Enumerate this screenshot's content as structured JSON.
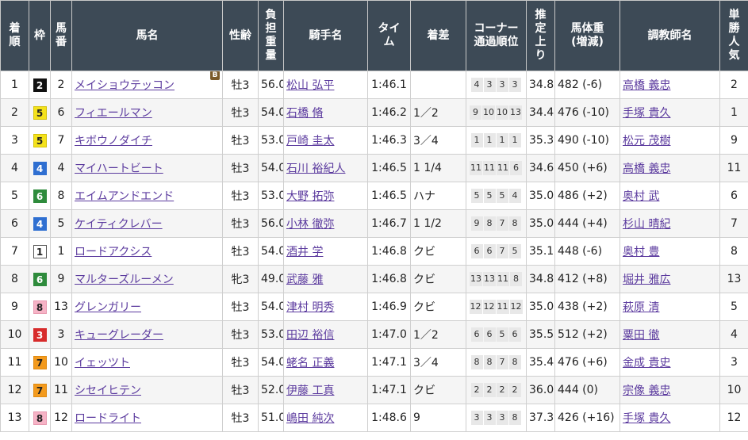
{
  "headers": {
    "rank": [
      "着",
      "順"
    ],
    "waku": [
      "枠"
    ],
    "umaban": [
      "馬",
      "番"
    ],
    "name": [
      "馬名"
    ],
    "sexage": [
      "性齢"
    ],
    "weight": [
      "負",
      "担",
      "重",
      "量"
    ],
    "jockey": [
      "騎手名"
    ],
    "time": [
      "タイ",
      "ム"
    ],
    "margin": [
      "着差"
    ],
    "corner": [
      "コーナー",
      "通過順位"
    ],
    "agari": [
      "推",
      "定",
      "上",
      "り"
    ],
    "body": [
      "馬体重",
      "(増減)"
    ],
    "trainer": [
      "調教師名"
    ],
    "pop": [
      "単",
      "勝",
      "人",
      "気"
    ]
  },
  "waku_colors": {
    "1": {
      "bg": "#ffffff",
      "fg": "#222222",
      "border": "#555555"
    },
    "2": {
      "bg": "#111111",
      "fg": "#ffffff",
      "border": "#111111"
    },
    "3": {
      "bg": "#d72b2b",
      "fg": "#ffffff",
      "border": "#d72b2b"
    },
    "4": {
      "bg": "#2f6fd1",
      "fg": "#ffffff",
      "border": "#2f6fd1"
    },
    "5": {
      "bg": "#f4e21b",
      "fg": "#222222",
      "border": "#d4c20b"
    },
    "6": {
      "bg": "#2e8b3c",
      "fg": "#ffffff",
      "border": "#2e8b3c"
    },
    "7": {
      "bg": "#f39a1d",
      "fg": "#222222",
      "border": "#e08a10"
    },
    "8": {
      "bg": "#f6b3c6",
      "fg": "#222222",
      "border": "#e89ab0"
    }
  },
  "rows": [
    {
      "rank": "1",
      "waku": "2",
      "umaban": "2",
      "name": "メイショウテッコン",
      "blinker": "B",
      "sexage": "牡3",
      "weight": "56.0",
      "jockey": "松山 弘平",
      "time": "1:46.1",
      "margin": "",
      "corner": [
        "4",
        "3",
        "3",
        "3"
      ],
      "agari": "34.8",
      "body": "482 (-6)",
      "trainer": "高橋 義忠",
      "pop": "2"
    },
    {
      "rank": "2",
      "waku": "5",
      "umaban": "6",
      "name": "フィエールマン",
      "blinker": "",
      "sexage": "牡3",
      "weight": "54.0",
      "jockey": "石橋 脩",
      "time": "1:46.2",
      "margin": "1／2",
      "corner": [
        "9",
        "10",
        "10",
        "13"
      ],
      "agari": "34.4",
      "body": "476 (-10)",
      "trainer": "手塚 貴久",
      "pop": "1"
    },
    {
      "rank": "3",
      "waku": "5",
      "umaban": "7",
      "name": "キボウノダイチ",
      "blinker": "",
      "sexage": "牡3",
      "weight": "53.0",
      "jockey": "戸崎 圭太",
      "time": "1:46.3",
      "margin": "3／4",
      "corner": [
        "1",
        "1",
        "1",
        "1"
      ],
      "agari": "35.3",
      "body": "490 (-10)",
      "trainer": "松元 茂樹",
      "pop": "9"
    },
    {
      "rank": "4",
      "waku": "4",
      "umaban": "4",
      "name": "マイハートビート",
      "blinker": "",
      "sexage": "牡3",
      "weight": "54.0",
      "jockey": "石川 裕紀人",
      "time": "1:46.5",
      "margin": "1 1/4",
      "corner": [
        "11",
        "11",
        "11",
        "6"
      ],
      "agari": "34.6",
      "body": "450 (+6)",
      "trainer": "高橋 義忠",
      "pop": "11"
    },
    {
      "rank": "5",
      "waku": "6",
      "umaban": "8",
      "name": "エイムアンドエンド",
      "blinker": "",
      "sexage": "牡3",
      "weight": "53.0",
      "jockey": "大野 拓弥",
      "time": "1:46.5",
      "margin": "ハナ",
      "corner": [
        "5",
        "5",
        "5",
        "4"
      ],
      "agari": "35.0",
      "body": "486 (+2)",
      "trainer": "奥村 武",
      "pop": "6"
    },
    {
      "rank": "6",
      "waku": "4",
      "umaban": "5",
      "name": "ケイティクレバー",
      "blinker": "",
      "sexage": "牡3",
      "weight": "56.0",
      "jockey": "小林 徹弥",
      "time": "1:46.7",
      "margin": "1 1/2",
      "corner": [
        "9",
        "8",
        "7",
        "8"
      ],
      "agari": "35.0",
      "body": "444 (+4)",
      "trainer": "杉山 晴紀",
      "pop": "7"
    },
    {
      "rank": "7",
      "waku": "1",
      "umaban": "1",
      "name": "ロードアクシス",
      "blinker": "",
      "sexage": "牡3",
      "weight": "54.0",
      "jockey": "酒井 学",
      "time": "1:46.8",
      "margin": "クビ",
      "corner": [
        "6",
        "6",
        "7",
        "5"
      ],
      "agari": "35.1",
      "body": "448 (-6)",
      "trainer": "奥村 豊",
      "pop": "8"
    },
    {
      "rank": "8",
      "waku": "6",
      "umaban": "9",
      "name": "マルターズルーメン",
      "blinker": "",
      "sexage": "牝3",
      "weight": "49.0",
      "jockey": "武藤 雅",
      "time": "1:46.8",
      "margin": "クビ",
      "corner": [
        "13",
        "13",
        "11",
        "8"
      ],
      "agari": "34.8",
      "body": "412 (+8)",
      "trainer": "堀井 雅広",
      "pop": "13"
    },
    {
      "rank": "9",
      "waku": "8",
      "umaban": "13",
      "name": "グレンガリー",
      "blinker": "",
      "sexage": "牡3",
      "weight": "54.0",
      "jockey": "津村 明秀",
      "time": "1:46.9",
      "margin": "クビ",
      "corner": [
        "12",
        "12",
        "11",
        "12"
      ],
      "agari": "35.0",
      "body": "438 (+2)",
      "trainer": "萩原 清",
      "pop": "5"
    },
    {
      "rank": "10",
      "waku": "3",
      "umaban": "3",
      "name": "キューグレーダー",
      "blinker": "",
      "sexage": "牡3",
      "weight": "53.0",
      "jockey": "田辺 裕信",
      "time": "1:47.0",
      "margin": "1／2",
      "corner": [
        "6",
        "6",
        "5",
        "6"
      ],
      "agari": "35.5",
      "body": "512 (+2)",
      "trainer": "粟田 徹",
      "pop": "4"
    },
    {
      "rank": "11",
      "waku": "7",
      "umaban": "10",
      "name": "イェッツト",
      "blinker": "",
      "sexage": "牡3",
      "weight": "54.0",
      "jockey": "蛯名 正義",
      "time": "1:47.1",
      "margin": "3／4",
      "corner": [
        "8",
        "8",
        "7",
        "8"
      ],
      "agari": "35.4",
      "body": "476 (+6)",
      "trainer": "金成 貴史",
      "pop": "3"
    },
    {
      "rank": "12",
      "waku": "7",
      "umaban": "11",
      "name": "シセイヒテン",
      "blinker": "",
      "sexage": "牡3",
      "weight": "52.0",
      "jockey": "伊藤 工真",
      "time": "1:47.1",
      "margin": "クビ",
      "corner": [
        "2",
        "2",
        "2",
        "2"
      ],
      "agari": "36.0",
      "body": "444 (0)",
      "trainer": "宗像 義忠",
      "pop": "10"
    },
    {
      "rank": "13",
      "waku": "8",
      "umaban": "12",
      "name": "ロードライト",
      "blinker": "",
      "sexage": "牡3",
      "weight": "51.0",
      "jockey": "嶋田 純次",
      "time": "1:48.6",
      "margin": "9",
      "corner": [
        "3",
        "3",
        "3",
        "8"
      ],
      "agari": "37.3",
      "body": "426 (+16)",
      "trainer": "手塚 貴久",
      "pop": "12"
    }
  ]
}
